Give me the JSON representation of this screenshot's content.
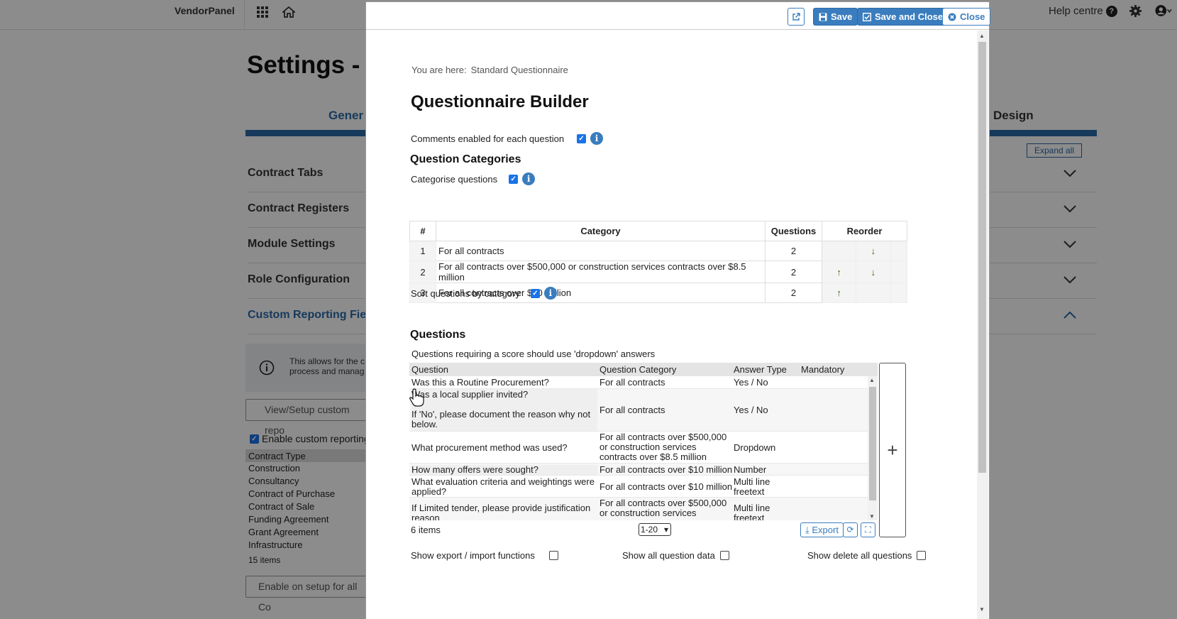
{
  "topbar": {
    "brand": "VendorPanel",
    "help": "Help centre"
  },
  "background": {
    "title": "Settings -",
    "tab_left": "Gener",
    "tab_right": "Design",
    "expand_all": "Expand all",
    "sections": [
      "Contract Tabs",
      "Contract Registers",
      "Module Settings",
      "Role Configuration",
      "Custom Reporting Fie"
    ],
    "info_text": [
      "This allows for the c",
      "process and manag"
    ],
    "view_setup_btn": "View/Setup custom repo",
    "enable_custom": "Enable custom reporting",
    "list_header": "Contract Type",
    "list_items": [
      "Construction",
      "Consultancy",
      "Contract of Purchase",
      "Contract of Sale",
      "Funding Agreement",
      "Grant Agreement",
      "Infrastructure"
    ],
    "list_count": "15 items",
    "enable_all_btn": "Enable on setup for all Co"
  },
  "modal": {
    "buttons": {
      "save": "Save",
      "save_close": "Save and Close",
      "close": "Close"
    },
    "breadcrumb_label": "You are here:",
    "breadcrumb_value": "Standard Questionnaire",
    "title": "Questionnaire Builder",
    "comments_label": "Comments enabled for each question",
    "categories_heading": "Question Categories",
    "categorise_label": "Categorise questions",
    "cat_table": {
      "headers": [
        "#",
        "Category",
        "Questions",
        "Reorder"
      ],
      "rows": [
        {
          "num": "1",
          "name": "For all contracts",
          "questions": "2",
          "up": "",
          "down": "↓"
        },
        {
          "num": "2",
          "name": "For all contracts over $500,000 or construction services contracts over $8.5 million",
          "questions": "2",
          "up": "↑",
          "down": "↓"
        },
        {
          "num": "3",
          "name": "For all contracts over $10 million",
          "questions": "2",
          "up": "↑",
          "down": ""
        }
      ]
    },
    "sort_label": "Sort questions by category",
    "questions_heading": "Questions",
    "questions_note": "Questions requiring a score should use 'dropdown' answers",
    "q_grid": {
      "headers": [
        "Question",
        "Question Category",
        "Answer Type",
        "Mandatory"
      ],
      "rows": [
        {
          "q": "Was this a Routine Procurement?",
          "cat": "For all contracts",
          "type": "Yes / No"
        },
        {
          "q": "Was a local supplier invited?\n\nIf 'No', please document the reason why not below.",
          "cat": "For all contracts",
          "type": "Yes / No"
        },
        {
          "q": "What procurement method was used?",
          "cat": "For all contracts over $500,000 or construction services contracts over $8.5 million",
          "type": "Dropdown"
        },
        {
          "q": "How many offers were sought?",
          "cat": "For all contracts over $10 million",
          "type": "Number"
        },
        {
          "q": "What evaluation criteria and weightings were applied?",
          "cat": "For all contracts over $10 million",
          "type": "Multi line freetext"
        },
        {
          "q": "If Limited tender, please provide justification reason",
          "cat": "For all contracts over $500,000 or construction services",
          "type": "Multi line freetext"
        }
      ]
    },
    "items_count": "6 items",
    "page_size": "1-20",
    "export": "Export",
    "add": "+",
    "show_export_import": "Show export / import functions",
    "show_all_data": "Show all question data",
    "show_delete_all": "Show delete all questions"
  }
}
